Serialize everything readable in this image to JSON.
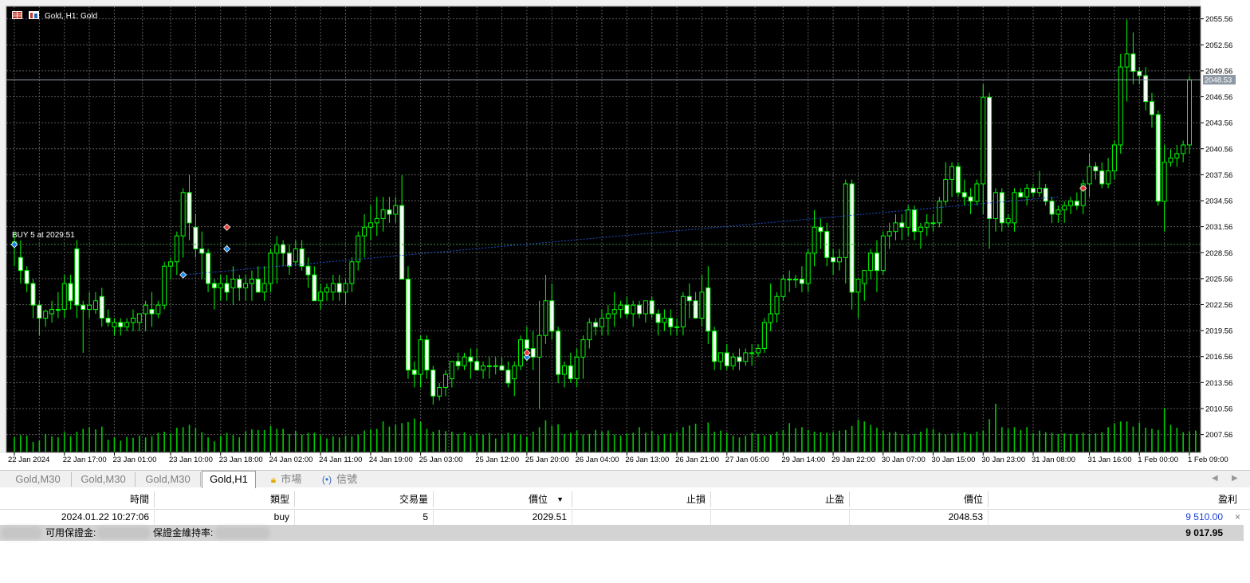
{
  "chart": {
    "title": "Gold, H1: Gold",
    "order_label": "BUY 5 at 2029.51",
    "current_price_tag": "2048.53",
    "price_levels": [
      "2055.56",
      "2052.56",
      "2049.56",
      "2046.56",
      "2043.56",
      "2040.56",
      "2037.56",
      "2034.56",
      "2031.56",
      "2028.56",
      "2025.56",
      "2022.56",
      "2019.56",
      "2016.56",
      "2013.56",
      "2010.56",
      "2007.56"
    ],
    "time_labels": [
      "22 Jan 2024",
      "22 Jan 17:00",
      "23 Jan 01:00",
      "23 Jan 10:00",
      "23 Jan 18:00",
      "24 Jan 02:00",
      "24 Jan 11:00",
      "24 Jan 19:00",
      "25 Jan 03:00",
      "25 Jan 12:00",
      "25 Jan 20:00",
      "26 Jan 04:00",
      "26 Jan 13:00",
      "26 Jan 21:00",
      "27 Jan 05:00",
      "29 Jan 14:00",
      "29 Jan 22:00",
      "30 Jan 07:00",
      "30 Jan 15:00",
      "30 Jan 23:00",
      "31 Jan 08:00",
      "31 Jan 16:00",
      "1 Feb 00:00",
      "1 Feb 09:00"
    ],
    "colors": {
      "background": "#000000",
      "grid": "#5a5a5a",
      "candle": "#00ff00",
      "bull_body": "#000000",
      "bear_body": "#ffffff",
      "volume": "#00cc00",
      "text": "#ffffff",
      "trade_line": "#1e50c8"
    }
  },
  "tabs": [
    {
      "label": "Gold,M30",
      "active": false
    },
    {
      "label": "Gold,M30",
      "active": false
    },
    {
      "label": "Gold,M30",
      "active": false
    },
    {
      "label": "Gold,H1",
      "active": true
    }
  ],
  "panel_tabs": [
    {
      "icon": "lock-icon",
      "label": "市場"
    },
    {
      "icon": "signal-icon",
      "label": "信號"
    }
  ],
  "terminal": {
    "columns": [
      "時間",
      "類型",
      "交易量",
      "價位",
      "止損",
      "止盈",
      "價位",
      "盈利"
    ],
    "sort_indicator": "▼",
    "row": {
      "time": "2024.01.22 10:27:06",
      "type": "buy",
      "volume": "5",
      "open_price": "2029.51",
      "sl": "",
      "tp": "",
      "price": "2048.53",
      "profit": "9 510.00",
      "close": "×"
    },
    "summary": {
      "free_margin_label": "可用保證金:",
      "margin_level_label": "保證金維持率:",
      "total": "9 017.95"
    }
  },
  "chart_data": {
    "type": "candlestick",
    "title": "Gold, H1: Gold",
    "ylim": [
      2005.5,
      2057
    ],
    "candles": [
      [
        2029.5,
        2031,
        2027,
        2029.8
      ],
      [
        2028,
        2030,
        2025,
        2026.5
      ],
      [
        2026.5,
        2027,
        2024,
        2025
      ],
      [
        2025,
        2025.5,
        2021,
        2022.5
      ],
      [
        2022.5,
        2023,
        2019,
        2021
      ],
      [
        2021,
        2022,
        2020,
        2021.8
      ],
      [
        2021.5,
        2023,
        2020.5,
        2022
      ],
      [
        2022,
        2024,
        2021,
        2022
      ],
      [
        2022,
        2026,
        2021,
        2025
      ],
      [
        2025,
        2026,
        2022,
        2023
      ],
      [
        2029,
        2030,
        2021,
        2022.5
      ],
      [
        2022.5,
        2023,
        2017,
        2022
      ],
      [
        2022,
        2024,
        2021,
        2022.5
      ],
      [
        2022,
        2024,
        2021.5,
        2023
      ],
      [
        2023.5,
        2024.5,
        2020,
        2021
      ],
      [
        2021,
        2022,
        2020,
        2020.5
      ],
      [
        2020,
        2021,
        2019,
        2020.5
      ],
      [
        2020.5,
        2021,
        2019,
        2020
      ],
      [
        2020,
        2021,
        2019.5,
        2020.5
      ],
      [
        2020.5,
        2022,
        2019.5,
        2021
      ],
      [
        2020.5,
        2021.5,
        2019.5,
        2021.5
      ],
      [
        2021.5,
        2023,
        2019.5,
        2022.5
      ],
      [
        2022,
        2024,
        2020,
        2021.5
      ],
      [
        2021.5,
        2023,
        2021,
        2022.5
      ],
      [
        2022.5,
        2027.5,
        2022,
        2027
      ],
      [
        2027,
        2028,
        2025.5,
        2027.5
      ],
      [
        2027.5,
        2031,
        2026,
        2030.5
      ],
      [
        2030.5,
        2036,
        2028,
        2035.5
      ],
      [
        2035.5,
        2037.5,
        2030,
        2032
      ],
      [
        2031.5,
        2033,
        2028,
        2029
      ],
      [
        2029,
        2031,
        2025.5,
        2028.5
      ],
      [
        2028.5,
        2029,
        2024,
        2025
      ],
      [
        2025,
        2025.5,
        2022,
        2024.5
      ],
      [
        2024.5,
        2026,
        2023,
        2025
      ],
      [
        2025,
        2026,
        2023,
        2024
      ],
      [
        2024.5,
        2027,
        2022.5,
        2025.5
      ],
      [
        2025.5,
        2026,
        2023,
        2024.5
      ],
      [
        2024.5,
        2026,
        2023,
        2025
      ],
      [
        2025,
        2026.5,
        2023,
        2025.5
      ],
      [
        2025.5,
        2027,
        2024,
        2024
      ],
      [
        2024,
        2027,
        2023,
        2025
      ],
      [
        2025,
        2029,
        2024,
        2028.5
      ],
      [
        2028.5,
        2030.5,
        2025,
        2029.5
      ],
      [
        2029.5,
        2030,
        2027,
        2028.5
      ],
      [
        2028.5,
        2029.5,
        2026,
        2027
      ],
      [
        2027.5,
        2030,
        2027,
        2029
      ],
      [
        2029,
        2030,
        2026.5,
        2027
      ],
      [
        2027,
        2028,
        2024.5,
        2026
      ],
      [
        2026,
        2027,
        2023,
        2023
      ],
      [
        2023,
        2025,
        2022,
        2024
      ],
      [
        2024,
        2025,
        2023,
        2024.5
      ],
      [
        2024,
        2026,
        2023,
        2025
      ],
      [
        2025,
        2026,
        2023,
        2024
      ],
      [
        2024,
        2025.5,
        2022.5,
        2025
      ],
      [
        2025,
        2028,
        2024,
        2027.5
      ],
      [
        2027.5,
        2031,
        2026.5,
        2030.5
      ],
      [
        2030.5,
        2033,
        2028,
        2031.5
      ],
      [
        2031.5,
        2034,
        2030,
        2032
      ],
      [
        2032,
        2035,
        2030.5,
        2032.5
      ],
      [
        2032.5,
        2035,
        2031,
        2033.5
      ],
      [
        2033.5,
        2035,
        2032,
        2033
      ],
      [
        2033,
        2035,
        2032,
        2034
      ],
      [
        2034,
        2037.5,
        2029,
        2025.5
      ],
      [
        2025.5,
        2027,
        2014,
        2015
      ],
      [
        2015,
        2016,
        2013,
        2014.5
      ],
      [
        2014.5,
        2019,
        2013,
        2018.5
      ],
      [
        2018.5,
        2019,
        2014,
        2015
      ],
      [
        2015,
        2015.5,
        2011,
        2012
      ],
      [
        2012,
        2013.5,
        2011.5,
        2013
      ],
      [
        2013,
        2015,
        2012,
        2014.5
      ],
      [
        2014,
        2016,
        2013,
        2016
      ],
      [
        2016,
        2017,
        2015,
        2015.5
      ],
      [
        2015.5,
        2017,
        2015,
        2016.5
      ],
      [
        2016.5,
        2017.5,
        2014,
        2016
      ],
      [
        2016,
        2017.5,
        2015,
        2015
      ],
      [
        2015,
        2016,
        2014,
        2015.5
      ],
      [
        2015.5,
        2016.5,
        2014,
        2015.5
      ],
      [
        2015.5,
        2016.5,
        2014.5,
        2015.5
      ],
      [
        2015.5,
        2016.5,
        2015,
        2015
      ],
      [
        2015,
        2016,
        2013,
        2013.5
      ],
      [
        2014,
        2016,
        2012,
        2015.5
      ],
      [
        2015.5,
        2019,
        2015,
        2018.5
      ],
      [
        2018.5,
        2020,
        2016,
        2017.5
      ],
      [
        2017.5,
        2019.5,
        2015,
        2016.5
      ],
      [
        2016.5,
        2023,
        2010.5,
        2019
      ],
      [
        2019,
        2026,
        2018,
        2023
      ],
      [
        2023,
        2025,
        2018.5,
        2019.5
      ],
      [
        2019.5,
        2020,
        2013.5,
        2014.5
      ],
      [
        2014.5,
        2016,
        2013,
        2015.5
      ],
      [
        2015.5,
        2017,
        2013.5,
        2014
      ],
      [
        2014,
        2017.5,
        2013,
        2016.5
      ],
      [
        2016.5,
        2019,
        2014,
        2018.5
      ],
      [
        2018.5,
        2021,
        2017.5,
        2020.5
      ],
      [
        2020.5,
        2021,
        2019,
        2020
      ],
      [
        2020,
        2022,
        2019,
        2021
      ],
      [
        2021,
        2022.5,
        2019,
        2021.5
      ],
      [
        2021.5,
        2024,
        2020,
        2022
      ],
      [
        2022,
        2023,
        2021,
        2022.5
      ],
      [
        2022.5,
        2023.5,
        2021,
        2021.5
      ],
      [
        2021.5,
        2023,
        2020,
        2022.5
      ],
      [
        2022.5,
        2023,
        2021,
        2021.5
      ],
      [
        2021.5,
        2023,
        2020.5,
        2023
      ],
      [
        2023,
        2023.5,
        2021,
        2021.5
      ],
      [
        2021.5,
        2022,
        2019,
        2020.5
      ],
      [
        2020.5,
        2022,
        2019.5,
        2021
      ],
      [
        2021,
        2022,
        2019,
        2020
      ],
      [
        2020,
        2021,
        2019,
        2020
      ],
      [
        2020,
        2024,
        2019,
        2023.5
      ],
      [
        2023.5,
        2025,
        2021,
        2023
      ],
      [
        2023,
        2024,
        2021,
        2021
      ],
      [
        2021,
        2026,
        2020,
        2024
      ],
      [
        2024.5,
        2027,
        2018,
        2019.5
      ],
      [
        2019.5,
        2020,
        2015,
        2016
      ],
      [
        2016,
        2017,
        2015,
        2017
      ],
      [
        2017,
        2018,
        2015,
        2015.5
      ],
      [
        2015.5,
        2017,
        2015,
        2016.5
      ],
      [
        2016.5,
        2017.5,
        2015,
        2016
      ],
      [
        2016,
        2017.5,
        2015.5,
        2017
      ],
      [
        2017,
        2018,
        2015.5,
        2017
      ],
      [
        2017,
        2018,
        2016.5,
        2017.5
      ],
      [
        2017.5,
        2021,
        2017,
        2020.5
      ],
      [
        2020.5,
        2025,
        2019.5,
        2021.5
      ],
      [
        2021.5,
        2024,
        2020.5,
        2023.5
      ],
      [
        2023.5,
        2026,
        2023,
        2025.5
      ],
      [
        2025.5,
        2026.5,
        2024,
        2025.5
      ],
      [
        2025.5,
        2026,
        2024.5,
        2025.5
      ],
      [
        2025.5,
        2027,
        2024,
        2025
      ],
      [
        2025,
        2029,
        2024,
        2028.5
      ],
      [
        2028.5,
        2033.5,
        2027,
        2031.5
      ],
      [
        2031.5,
        2032.5,
        2029,
        2031
      ],
      [
        2031,
        2032,
        2027,
        2028
      ],
      [
        2028,
        2029,
        2026,
        2027.5
      ],
      [
        2027.5,
        2029,
        2026.5,
        2028
      ],
      [
        2028,
        2037,
        2025,
        2036.5
      ],
      [
        2036.5,
        2037,
        2022,
        2024
      ],
      [
        2024,
        2025,
        2021,
        2025.5
      ],
      [
        2025,
        2026,
        2023,
        2026.5
      ],
      [
        2026.5,
        2029,
        2025.5,
        2028.5
      ],
      [
        2028.5,
        2030,
        2024,
        2026.5
      ],
      [
        2026.5,
        2031,
        2026,
        2030.5
      ],
      [
        2030.5,
        2032,
        2029,
        2031
      ],
      [
        2031,
        2033,
        2030,
        2032
      ],
      [
        2032,
        2033,
        2030,
        2031.5
      ],
      [
        2031.5,
        2034,
        2030.5,
        2033.5
      ],
      [
        2033.5,
        2034,
        2030,
        2031
      ],
      [
        2031,
        2032,
        2029,
        2031.5
      ],
      [
        2031.5,
        2033,
        2030.5,
        2032
      ],
      [
        2032,
        2033,
        2031,
        2032
      ],
      [
        2032,
        2035,
        2031.5,
        2034.5
      ],
      [
        2034.5,
        2039,
        2034,
        2037
      ],
      [
        2037,
        2039,
        2035,
        2038.5
      ],
      [
        2038.5,
        2039,
        2035,
        2035.5
      ],
      [
        2035.5,
        2037,
        2034,
        2035
      ],
      [
        2035,
        2036,
        2033,
        2034.5
      ],
      [
        2034.5,
        2037,
        2034,
        2036.5
      ],
      [
        2036.5,
        2048,
        2033,
        2046.5
      ],
      [
        2046.5,
        2047,
        2029,
        2032.5
      ],
      [
        2032.5,
        2036,
        2031,
        2035.5
      ],
      [
        2035.5,
        2036,
        2031,
        2032
      ],
      [
        2032,
        2033,
        2031.5,
        2032.5
      ],
      [
        2032,
        2036,
        2031,
        2035.5
      ],
      [
        2035.5,
        2036,
        2035,
        2035
      ],
      [
        2035,
        2036.5,
        2034,
        2036
      ],
      [
        2036,
        2036.5,
        2035,
        2035.5
      ],
      [
        2035.5,
        2038,
        2035,
        2036
      ],
      [
        2036,
        2036.5,
        2034,
        2034.5
      ],
      [
        2034.5,
        2035,
        2032,
        2033
      ],
      [
        2033,
        2034,
        2032,
        2033.5
      ],
      [
        2033.5,
        2034.5,
        2032,
        2034
      ],
      [
        2034,
        2035,
        2033,
        2034.5
      ],
      [
        2034.5,
        2035.5,
        2033.5,
        2034
      ],
      [
        2034,
        2037,
        2033,
        2036.5
      ],
      [
        2036.5,
        2040,
        2035,
        2038.5
      ],
      [
        2038.5,
        2039,
        2037,
        2038
      ],
      [
        2038,
        2039,
        2036,
        2036.5
      ],
      [
        2036.5,
        2039.5,
        2036,
        2038
      ],
      [
        2038,
        2041.5,
        2037,
        2041
      ],
      [
        2041,
        2051.5,
        2040,
        2050
      ],
      [
        2050,
        2055.5,
        2046,
        2051.5
      ],
      [
        2051.5,
        2054,
        2048,
        2049.5
      ],
      [
        2049.5,
        2050,
        2048,
        2049
      ],
      [
        2049,
        2050,
        2045,
        2046
      ],
      [
        2046,
        2047,
        2043,
        2044.5
      ],
      [
        2044.5,
        2045,
        2034,
        2034.5
      ],
      [
        2034.5,
        2041,
        2031,
        2039
      ],
      [
        2039,
        2040.5,
        2038.5,
        2039.5
      ],
      [
        2039.5,
        2041,
        2038.5,
        2040
      ],
      [
        2040,
        2041.5,
        2039,
        2041
      ],
      [
        2041,
        2049,
        2040,
        2048.5
      ]
    ],
    "volume": [
      26,
      29,
      28,
      17,
      19,
      31,
      27,
      25,
      34,
      27,
      35,
      40,
      43,
      39,
      44,
      21,
      25,
      19,
      26,
      24,
      28,
      25,
      27,
      33,
      35,
      32,
      42,
      43,
      47,
      41,
      34,
      25,
      18,
      28,
      33,
      29,
      25,
      35,
      39,
      38,
      38,
      45,
      40,
      40,
      31,
      36,
      30,
      33,
      33,
      29,
      23,
      27,
      25,
      28,
      27,
      30,
      37,
      39,
      40,
      53,
      44,
      47,
      50,
      52,
      58,
      52,
      40,
      35,
      38,
      36,
      35,
      31,
      34,
      28,
      32,
      30,
      33,
      23,
      31,
      33,
      31,
      30,
      26,
      35,
      43,
      55,
      45,
      48,
      31,
      33,
      37,
      30,
      31,
      38,
      35,
      37,
      30,
      28,
      32,
      33,
      43,
      33,
      36,
      29,
      31,
      32,
      34,
      43,
      46,
      49,
      32,
      51,
      35,
      37,
      33,
      28,
      25,
      28,
      33,
      31,
      28,
      30,
      35,
      38,
      50,
      41,
      43,
      38,
      35,
      34,
      33,
      34,
      37,
      38,
      45,
      56,
      53,
      47,
      42,
      37,
      34,
      35,
      31,
      30,
      31,
      35,
      41,
      39,
      33,
      30,
      32,
      33,
      34,
      31,
      35,
      37,
      57,
      84,
      43,
      40,
      43,
      38,
      43,
      32,
      37,
      34,
      33,
      31,
      32,
      31,
      31,
      33,
      31,
      32,
      34,
      43,
      50,
      53,
      53,
      44,
      51,
      42,
      40,
      38,
      77,
      47,
      42,
      34,
      35,
      37,
      43
    ]
  }
}
